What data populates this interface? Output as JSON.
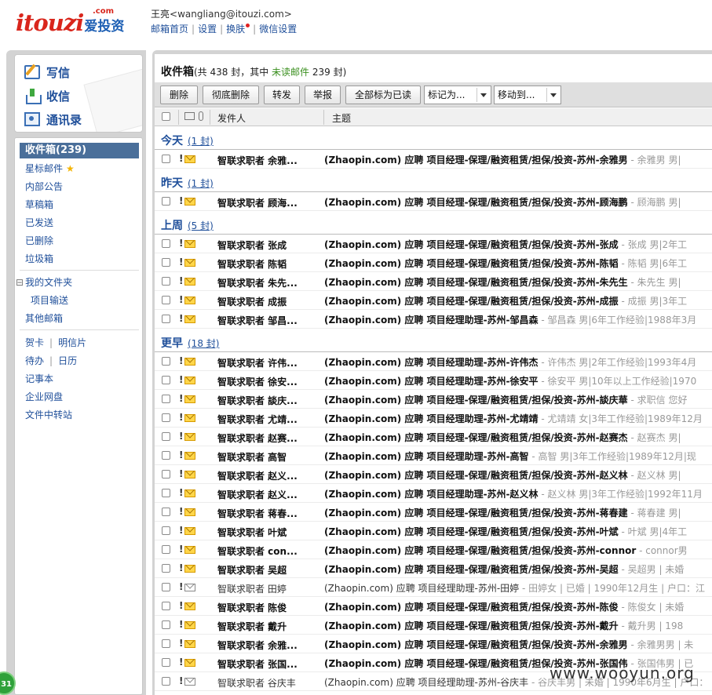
{
  "header": {
    "logo_brand": "itouzi",
    "logo_com": ".com",
    "logo_cn": "爱投资",
    "user_name": "王亮",
    "user_email": "<wangliang@itouzi.com>",
    "links": [
      "邮箱首页",
      "设置",
      "换肤",
      "微信设置"
    ]
  },
  "sidebar": {
    "compose": "写信",
    "receive": "收信",
    "contacts": "通讯录",
    "inbox": "收件箱(239)",
    "items": [
      "星标邮件",
      "内部公告",
      "草稿箱",
      "已发送",
      "已删除",
      "垃圾箱"
    ],
    "my_folders": "我的文件夹",
    "folder_items": [
      "项目输送"
    ],
    "other_mail": "其他邮箱",
    "tools_row1": [
      "贺卡",
      "明信片"
    ],
    "tools_row2": [
      "待办",
      "日历"
    ],
    "tools": [
      "记事本",
      "企业网盘",
      "文件中转站"
    ],
    "folder_toggle": "⊟"
  },
  "main": {
    "title": "收件箱",
    "summary_prefix": "(共 438 封，其中 ",
    "unread_label": "未读邮件",
    "summary_suffix": " 239 封)",
    "toolbar": [
      "删除",
      "彻底删除",
      "转发",
      "举报",
      "全部标为已读"
    ],
    "mark_as": "标记为...",
    "move_to": "移动到...",
    "col_from": "发件人",
    "col_subject": "主题"
  },
  "groups": [
    {
      "label": "今天",
      "count": "(1 封)",
      "rows": [
        {
          "from": "智联求职者 余雅...",
          "subject": "(Zhaopin.com) 应聘 项目经理-保理/融资租赁/担保/投资-苏州-余雅男",
          "preview": " - 余雅男 男|",
          "read": false
        }
      ]
    },
    {
      "label": "昨天",
      "count": "(1 封)",
      "rows": [
        {
          "from": "智联求职者 顾海...",
          "subject": "(Zhaopin.com) 应聘 项目经理-保理/融资租赁/担保/投资-苏州-顾海鹏",
          "preview": " - 顾海鹏 男|",
          "read": false
        }
      ]
    },
    {
      "label": "上周",
      "count": "(5 封)",
      "rows": [
        {
          "from": "智联求职者 张成",
          "subject": "(Zhaopin.com) 应聘 项目经理-保理/融资租赁/担保/投资-苏州-张成",
          "preview": " - 张成 男|2年工",
          "read": false
        },
        {
          "from": "智联求职者 陈韬",
          "subject": "(Zhaopin.com) 应聘 项目经理-保理/融资租赁/担保/投资-苏州-陈韬",
          "preview": " - 陈韬 男|6年工",
          "read": false
        },
        {
          "from": "智联求职者 朱先...",
          "subject": "(Zhaopin.com) 应聘 项目经理-保理/融资租赁/担保/投资-苏州-朱先生",
          "preview": " - 朱先生 男|",
          "read": false
        },
        {
          "from": "智联求职者 成振",
          "subject": "(Zhaopin.com) 应聘 项目经理-保理/融资租赁/担保/投资-苏州-成振",
          "preview": " - 成振 男|3年工",
          "read": false
        },
        {
          "from": "智联求职者 邹昌...",
          "subject": "(Zhaopin.com) 应聘 项目经理助理-苏州-邹昌森",
          "preview": " - 邹昌森 男|6年工作经验|1988年3月",
          "read": false
        }
      ]
    },
    {
      "label": "更早",
      "count": "(18 封)",
      "rows": [
        {
          "from": "智联求职者 许伟...",
          "subject": "(Zhaopin.com) 应聘 项目经理助理-苏州-许伟杰",
          "preview": " - 许伟杰 男|2年工作经验|1993年4月",
          "read": false
        },
        {
          "from": "智联求职者 徐安...",
          "subject": "(Zhaopin.com) 应聘 项目经理助理-苏州-徐安平",
          "preview": " - 徐安平 男|10年以上工作经验|1970",
          "read": false
        },
        {
          "from": "智联求职者 談庆...",
          "subject": "(Zhaopin.com) 应聘 项目经理-保理/融资租赁/担保/投资-苏州-談庆華",
          "preview": " - 求职信 您好",
          "read": false
        },
        {
          "from": "智联求职者 尤靖...",
          "subject": "(Zhaopin.com) 应聘 项目经理助理-苏州-尤靖靖",
          "preview": " - 尤靖靖 女|3年工作经验|1989年12月",
          "read": false
        },
        {
          "from": "智联求职者 赵赛...",
          "subject": "(Zhaopin.com) 应聘 项目经理-保理/融资租赁/担保/投资-苏州-赵赛杰",
          "preview": " - 赵赛杰 男|",
          "read": false
        },
        {
          "from": "智联求职者 高智",
          "subject": "(Zhaopin.com) 应聘 项目经理助理-苏州-高智",
          "preview": " - 高智 男|3年工作经验|1989年12月|现",
          "read": false
        },
        {
          "from": "智联求职者 赵义...",
          "subject": "(Zhaopin.com) 应聘 项目经理-保理/融资租赁/担保/投资-苏州-赵义林",
          "preview": " - 赵义林 男|",
          "read": false
        },
        {
          "from": "智联求职者 赵义...",
          "subject": "(Zhaopin.com) 应聘 项目经理助理-苏州-赵义林",
          "preview": " - 赵义林 男|3年工作经验|1992年11月",
          "read": false
        },
        {
          "from": "智联求职者 蒋春...",
          "subject": "(Zhaopin.com) 应聘 项目经理-保理/融资租赁/担保/投资-苏州-蒋春建",
          "preview": " - 蒋春建 男|",
          "read": false
        },
        {
          "from": "智联求职者 叶斌",
          "subject": "(Zhaopin.com) 应聘 项目经理-保理/融资租赁/担保/投资-苏州-叶斌",
          "preview": " - 叶斌 男|4年工",
          "read": false
        },
        {
          "from": "智联求职者 con...",
          "subject": "(Zhaopin.com) 应聘 项目经理-保理/融资租赁/担保/投资-苏州-connor",
          "preview": " - connor男",
          "read": false
        },
        {
          "from": "智联求职者 吴超",
          "subject": "(Zhaopin.com) 应聘 项目经理-保理/融资租赁/担保/投资-苏州-吴超",
          "preview": " - 吴超男 | 未婚",
          "read": false
        },
        {
          "from": "智联求职者 田婷",
          "subject": "(Zhaopin.com) 应聘 项目经理助理-苏州-田婷",
          "preview": " - 田婷女 | 已婚 | 1990年12月生 | 户口：江",
          "read": true
        },
        {
          "from": "智联求职者 陈俊",
          "subject": "(Zhaopin.com) 应聘 项目经理-保理/融资租赁/担保/投资-苏州-陈俊",
          "preview": " - 陈俊女 | 未婚",
          "read": false
        },
        {
          "from": "智联求职者 戴升",
          "subject": "(Zhaopin.com) 应聘 项目经理-保理/融资租赁/担保/投资-苏州-戴升",
          "preview": " - 戴升男 | 198",
          "read": false
        },
        {
          "from": "智联求职者 余雅...",
          "subject": "(Zhaopin.com) 应聘 项目经理-保理/融资租赁/担保/投资-苏州-余雅男",
          "preview": " - 余雅男男 | 未",
          "read": false
        },
        {
          "from": "智联求职者 张国...",
          "subject": "(Zhaopin.com) 应聘 项目经理-保理/融资租赁/担保/投资-苏州-张国伟",
          "preview": " - 张国伟男 | 已",
          "read": false
        },
        {
          "from": "智联求职者 谷庆丰",
          "subject": "(Zhaopin.com) 应聘 项目经理助理-苏州-谷庆丰",
          "preview": " - 谷庆丰男 | 未婚 | 1990年6月生 | 户口：",
          "read": true
        }
      ]
    }
  ],
  "watermark": "www.wooyun.org",
  "badge": "31",
  "colors": {
    "brand_red": "#d9261c",
    "link_blue": "#1f4f9a",
    "unread_green": "#3a8f1e",
    "active_nav": "#4a6f9a"
  }
}
